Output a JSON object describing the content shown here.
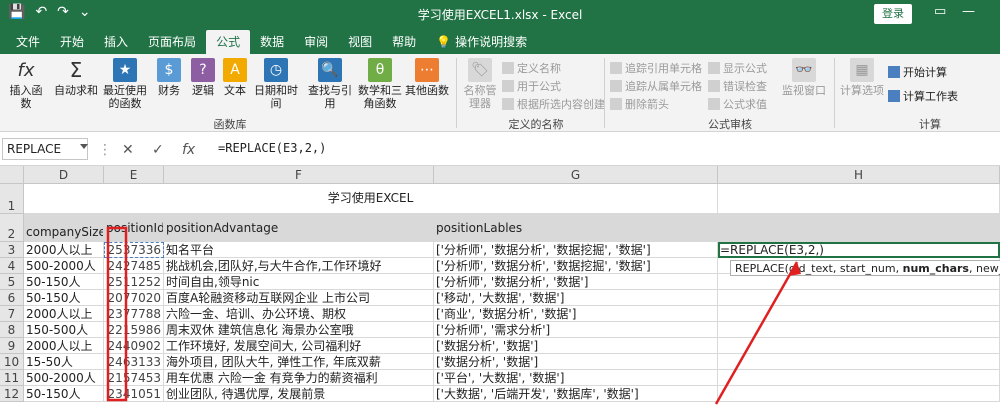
{
  "titlebar": {
    "document_title": "学习使用EXCEL1.xlsx  -  Excel",
    "login_label": "登录",
    "icons": [
      "save-icon",
      "undo-icon",
      "redo-icon",
      "customize-icon"
    ]
  },
  "tabs": [
    {
      "label": "文件",
      "active": false
    },
    {
      "label": "开始",
      "active": false
    },
    {
      "label": "插入",
      "active": false
    },
    {
      "label": "页面布局",
      "active": false
    },
    {
      "label": "公式",
      "active": true
    },
    {
      "label": "数据",
      "active": false
    },
    {
      "label": "审阅",
      "active": false
    },
    {
      "label": "视图",
      "active": false
    },
    {
      "label": "帮助",
      "active": false
    }
  ],
  "tell_me": "操作说明搜索",
  "ribbon": {
    "insert_function": "插入函数",
    "autosum": "自动求和",
    "recent": "最近使用的函数",
    "financial": "财务",
    "logical": "逻辑",
    "text": "文本",
    "datetime": "日期和时间",
    "lookup": "查找与引用",
    "math": "数学和三角函数",
    "other": "其他函数",
    "group_library": "函数库",
    "name_manager": "名称管理器",
    "define_name": "定义名称",
    "use_in_formula": "用于公式",
    "create_from_selection": "根据所选内容创建",
    "group_names": "定义的名称",
    "trace_precedents": "追踪引用单元格",
    "trace_dependents": "追踪从属单元格",
    "remove_arrows": "删除箭头",
    "show_formulas": "显示公式",
    "error_checking": "错误检查",
    "evaluate_formula": "公式求值",
    "group_audit": "公式审核",
    "watch_window": "监视窗口",
    "calc_options": "计算选项",
    "calc_now": "开始计算",
    "calc_sheet": "计算工作表",
    "group_calc": "计算"
  },
  "formula_bar": {
    "name_box": "REPLACE",
    "formula": "=REPLACE(E3,2,)"
  },
  "grid": {
    "columns": [
      "D",
      "E",
      "F",
      "G",
      "H"
    ],
    "title": "学习使用EXCEL",
    "headers": [
      "companySize",
      "positionId",
      "positionAdvantage",
      "positionLables",
      ""
    ],
    "rows": [
      {
        "rn": "3",
        "d": "2000人以上",
        "e": "2537336",
        "f": "知名平台",
        "g": "['分析师', '数据分析', '数据挖掘', '数据']",
        "h": "=REPLACE(E3,2,)"
      },
      {
        "rn": "4",
        "d": "500-2000人",
        "e": "2427485",
        "f": "挑战机会,团队好,与大牛合作,工作环境好",
        "g": "['分析师', '数据分析', '数据挖掘', '数据']",
        "h": ""
      },
      {
        "rn": "5",
        "d": "50-150人",
        "e": "2511252",
        "f": "时间自由,领导nic",
        "g": "['分析师', '数据分析', '数据']",
        "h": ""
      },
      {
        "rn": "6",
        "d": "50-150人",
        "e": "2077020",
        "f": "百度A轮融资移动互联网企业 上市公司",
        "g": "['移动', '大数据', '数据']",
        "h": ""
      },
      {
        "rn": "7",
        "d": "2000人以上",
        "e": "2377788",
        "f": "六险一金、培训、办公环境、期权",
        "g": "['商业', '数据分析', '数据']",
        "h": ""
      },
      {
        "rn": "8",
        "d": "150-500人",
        "e": "2215986",
        "f": "周末双休 建筑信息化 海景办公室哦",
        "g": "['分析师', '需求分析']",
        "h": ""
      },
      {
        "rn": "9",
        "d": "2000人以上",
        "e": "2440902",
        "f": "工作环境好, 发展空间大, 公司福利好",
        "g": "['数据分析', '数据']",
        "h": ""
      },
      {
        "rn": "10",
        "d": "15-50人",
        "e": "2463133",
        "f": "海外项目, 团队大牛, 弹性工作, 年底双薪",
        "g": "['数据分析', '数据']",
        "h": ""
      },
      {
        "rn": "11",
        "d": "500-2000人",
        "e": "2157453",
        "f": "用车优惠 六险一金 有竞争力的薪资福利",
        "g": "['平台', '大数据', '数据']",
        "h": ""
      },
      {
        "rn": "12",
        "d": "50-150人",
        "e": "2341051",
        "f": "创业团队, 待遇优厚, 发展前景",
        "g": "['大数据', '后端开发', '数据库', '数据']",
        "h": ""
      }
    ],
    "tooltip": {
      "prefix": "REPLACE(old_text, start_num, ",
      "bold": "num_chars",
      "suffix": ", new_text)"
    }
  },
  "annotations": {
    "color": "#e02020"
  },
  "colors": {
    "excel_green": "#217346"
  }
}
